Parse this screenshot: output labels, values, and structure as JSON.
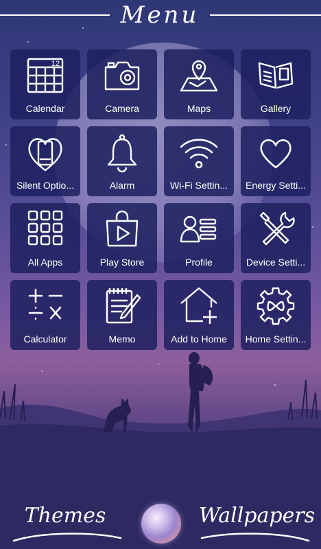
{
  "header": {
    "title": "Menu"
  },
  "tiles": [
    {
      "label": "Calendar",
      "icon": "calendar-icon"
    },
    {
      "label": "Camera",
      "icon": "camera-icon"
    },
    {
      "label": "Maps",
      "icon": "map-icon"
    },
    {
      "label": "Gallery",
      "icon": "gallery-icon"
    },
    {
      "label": "Silent Optio...",
      "icon": "silent-phone-icon"
    },
    {
      "label": "Alarm",
      "icon": "bell-icon"
    },
    {
      "label": "Wi-Fi Settin...",
      "icon": "wifi-icon"
    },
    {
      "label": "Energy Setti...",
      "icon": "heart-icon"
    },
    {
      "label": "All Apps",
      "icon": "grid-icon"
    },
    {
      "label": "Play Store",
      "icon": "play-store-icon"
    },
    {
      "label": "Profile",
      "icon": "profile-icon"
    },
    {
      "label": "Device Setti...",
      "icon": "tools-icon"
    },
    {
      "label": "Calculator",
      "icon": "calculator-icon"
    },
    {
      "label": "Memo",
      "icon": "memo-icon"
    },
    {
      "label": "Add to Home",
      "icon": "add-home-icon"
    },
    {
      "label": "Home Settin...",
      "icon": "gear-icon"
    }
  ],
  "calendar_number": "12",
  "bottom": {
    "themes_label": "Themes",
    "wallpapers_label": "Wallpapers"
  },
  "colors": {
    "tile_bg": "#1e2160",
    "sky_top": "#2f3775",
    "sky_mid": "#8d5f9c"
  }
}
